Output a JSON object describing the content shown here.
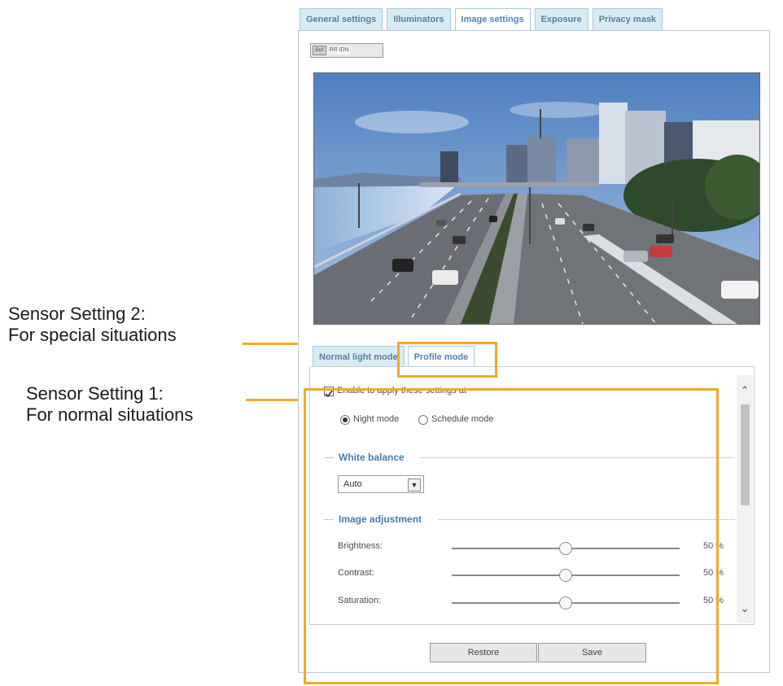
{
  "callouts": {
    "setting2_line1": "Sensor Setting 2:",
    "setting2_line2": "For special situations",
    "setting1_line1": "Sensor Setting 1:",
    "setting1_line2": "For normal situations",
    "highlight_color": "#f0a830"
  },
  "tabs": [
    {
      "label": "General settings",
      "active": false
    },
    {
      "label": "Illuminators",
      "active": false
    },
    {
      "label": "Image settings",
      "active": true
    },
    {
      "label": "Exposure",
      "active": false
    },
    {
      "label": "Privacy mask",
      "active": false
    }
  ],
  "live_view": {
    "legacy_button_left": "Aut",
    "legacy_button_right": "RR IDN"
  },
  "mode_tabs": [
    {
      "label": "Normal light mode",
      "active": false
    },
    {
      "label": "Profile mode",
      "active": true
    }
  ],
  "profile": {
    "enable_label": "Enable to apply these settings at",
    "enable_checked": true,
    "night_mode_label": "Night mode",
    "schedule_mode_label": "Schedule mode",
    "selected_mode": "Night mode"
  },
  "white_balance": {
    "title": "White balance",
    "selected": "Auto"
  },
  "image_adjustment": {
    "title": "Image adjustment",
    "sliders": [
      {
        "label": "Brightness:",
        "value": 50,
        "display": "50 %"
      },
      {
        "label": "Contrast:",
        "value": 50,
        "display": "50 %"
      },
      {
        "label": "Saturation:",
        "value": 50,
        "display": "50 %"
      }
    ]
  },
  "buttons": {
    "restore": "Restore",
    "save": "Save"
  }
}
